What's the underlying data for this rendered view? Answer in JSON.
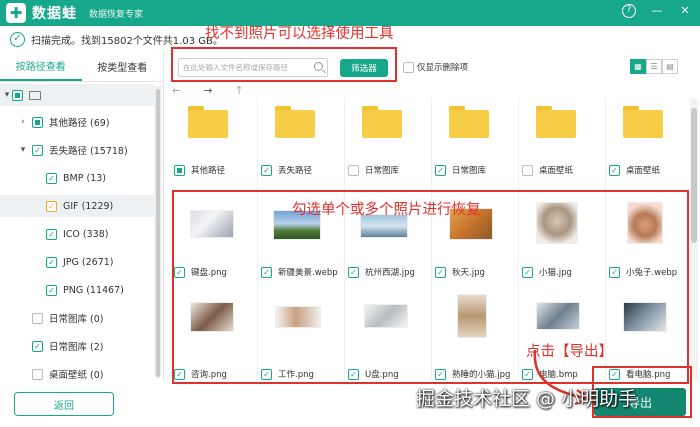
{
  "titlebar": {
    "app_name": "数据蛙",
    "subtitle": "数据恢复专家",
    "help": "?",
    "minimize": "—",
    "close": "✕"
  },
  "status": {
    "prefix": "扫描完成。找到",
    "count": "15802",
    "suffix": "个文件共1.03 GB。"
  },
  "tabs": {
    "by_path": "按路径查看",
    "by_type": "按类型查看"
  },
  "tree": [
    {
      "label": "其他路径 (69)"
    },
    {
      "label": "丢失路径 (15718)"
    },
    {
      "label": "BMP (13)"
    },
    {
      "label": "GIF (1229)"
    },
    {
      "label": "ICO (338)"
    },
    {
      "label": "JPG (2671)"
    },
    {
      "label": "PNG (11467)"
    },
    {
      "label": "日常图库 (0)"
    },
    {
      "label": "日常图库 (2)"
    },
    {
      "label": "桌面壁纸 (0)"
    }
  ],
  "back_button": "返回",
  "toolbar": {
    "search_placeholder": "在此处输入文件名称或保存路径",
    "filter_label": "筛选器",
    "only_deleted": "仅显示删除项"
  },
  "folders": [
    {
      "name": "其他路径"
    },
    {
      "name": "丢失路径"
    },
    {
      "name": "日常图库"
    },
    {
      "name": "日常图库"
    },
    {
      "name": "桌面壁纸"
    },
    {
      "name": "桌面壁纸"
    }
  ],
  "files_row1": [
    {
      "name": "键盘.png"
    },
    {
      "name": "新疆美景.webp"
    },
    {
      "name": "杭州西湖.jpg"
    },
    {
      "name": "秋天.jpg"
    },
    {
      "name": "小猫.jpg"
    },
    {
      "name": "小兔子.webp"
    }
  ],
  "files_row2": [
    {
      "name": "咨询.png"
    },
    {
      "name": "工作.png"
    },
    {
      "name": "U盘.png"
    },
    {
      "name": "熟睡的小猫.jpg"
    },
    {
      "name": "电脑.bmp"
    },
    {
      "name": "看电脑.png"
    }
  ],
  "annotations": {
    "tool_hint": "找不到照片可以选择使用工具",
    "select_hint": "勾选单个或多个照片进行恢复",
    "export_hint": "点击【导出】"
  },
  "export_button": "导出",
  "watermark": "掘金技术社区 @ 小明助手",
  "colors": {
    "brand": "#17a78a",
    "annotation": "#e0322d",
    "folder": "#f7cc47"
  }
}
